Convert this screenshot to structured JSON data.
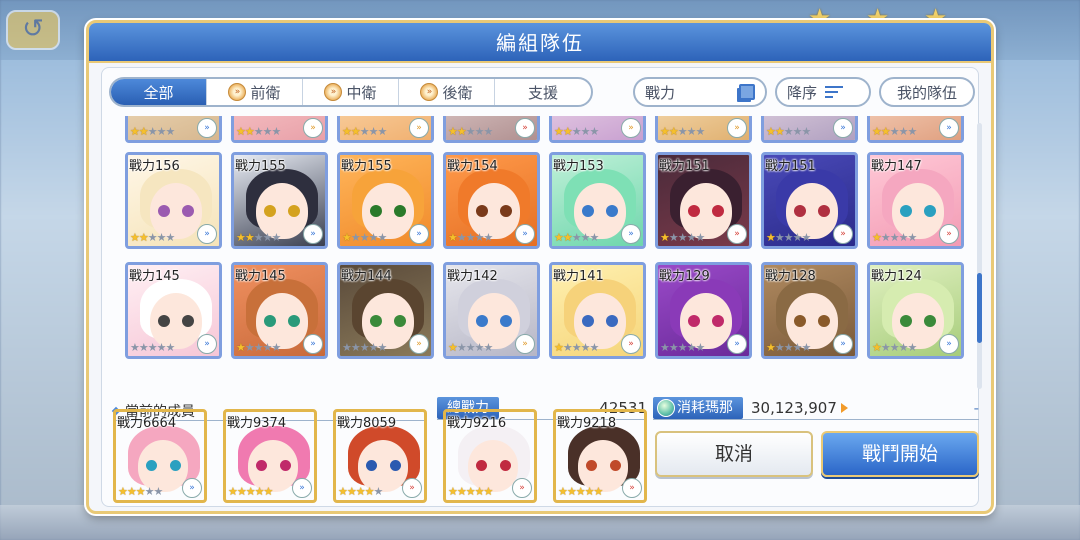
{
  "background": {
    "back_label": "↺"
  },
  "dialog": {
    "title": "編組隊伍"
  },
  "filters": {
    "tabs": [
      {
        "label": "全部",
        "active": true,
        "icon": false
      },
      {
        "label": "前衛",
        "active": false,
        "icon": true
      },
      {
        "label": "中衛",
        "active": false,
        "icon": true
      },
      {
        "label": "後衛",
        "active": false,
        "icon": true
      },
      {
        "label": "支援",
        "active": false,
        "icon": false
      }
    ],
    "sort_key_label": "戰力",
    "sort_order_label": "降序",
    "my_team_label": "我的隊伍"
  },
  "roster_rows": [
    [
      {
        "power": "",
        "stars": 2,
        "arrow": "blue",
        "palette": [
          "#f5e6c8",
          "#d7b78f"
        ]
      },
      {
        "power": "",
        "stars": 2,
        "arrow": "orange",
        "palette": [
          "#ffd6d6",
          "#e8a0a8"
        ]
      },
      {
        "power": "",
        "stars": 2,
        "arrow": "orange",
        "palette": [
          "#ffe5c0",
          "#f0b070"
        ]
      },
      {
        "power": "",
        "stars": 2,
        "arrow": "red",
        "palette": [
          "#f0e0e0",
          "#b09090"
        ]
      },
      {
        "power": "",
        "stars": 2,
        "arrow": "orange",
        "palette": [
          "#f8e7f0",
          "#c8a0d0"
        ]
      },
      {
        "power": "",
        "stars": 2,
        "arrow": "orange",
        "palette": [
          "#fff0d0",
          "#e0b070"
        ]
      },
      {
        "power": "",
        "stars": 2,
        "arrow": "blue",
        "palette": [
          "#f6e6ee",
          "#b0a0c0"
        ]
      },
      {
        "power": "",
        "stars": 2,
        "arrow": "blue",
        "palette": [
          "#ffe8d8",
          "#e0a080"
        ]
      }
    ],
    [
      {
        "power": "戰力156",
        "stars": 2,
        "arrow": "blue",
        "palette": [
          "#fff7e8",
          "#f5e3b8"
        ],
        "hair": "#f6e6c0",
        "eye": "#9b5bb0"
      },
      {
        "power": "戰力155",
        "stars": 2,
        "arrow": "blue",
        "palette": [
          "#e8ecf4",
          "#3a3f50"
        ],
        "hair": "#2e2f3e",
        "eye": "#d4a21f"
      },
      {
        "power": "戰力155",
        "stars": 1,
        "arrow": "blue",
        "palette": [
          "#ffb55a",
          "#f08a2a"
        ],
        "hair": "#f7a33a",
        "eye": "#2a7a2a"
      },
      {
        "power": "戰力154",
        "stars": 1,
        "arrow": "blue",
        "palette": [
          "#ff9a4a",
          "#e56f24"
        ],
        "hair": "#f07a2a",
        "eye": "#7a3a1a"
      },
      {
        "power": "戰力153",
        "stars": 2,
        "arrow": "blue",
        "palette": [
          "#bff0d8",
          "#6ed6ac"
        ],
        "hair": "#7ee0b5",
        "eye": "#3a7acb"
      },
      {
        "power": "戰力151",
        "stars": 1,
        "arrow": "red",
        "palette": [
          "#4a2a3a",
          "#7a3a4a"
        ],
        "hair": "#3a2030",
        "eye": "#c02a40"
      },
      {
        "power": "戰力151",
        "stars": 1,
        "arrow": "red",
        "palette": [
          "#4a4ab8",
          "#2a2a8a"
        ],
        "hair": "#3a3aa8",
        "eye": "#b03040"
      },
      {
        "power": "戰力147",
        "stars": 1,
        "arrow": "red",
        "palette": [
          "#ffc8d6",
          "#f29bb4"
        ],
        "hair": "#f5a7c0",
        "eye": "#2aa0c0"
      }
    ],
    [
      {
        "power": "戰力145",
        "stars": 0,
        "arrow": "blue",
        "palette": [
          "#fff0f4",
          "#f6c6d6"
        ],
        "hair": "#ffffff",
        "eye": "#444444"
      },
      {
        "power": "戰力145",
        "stars": 1,
        "arrow": "blue",
        "palette": [
          "#f09060",
          "#c86a3a"
        ],
        "hair": "#c8703a",
        "eye": "#2a9a7a"
      },
      {
        "power": "戰力144",
        "stars": 0,
        "arrow": "orange",
        "palette": [
          "#5a4a3a",
          "#8a7a5a"
        ],
        "hair": "#5a4530",
        "eye": "#3a8a3a"
      },
      {
        "power": "戰力142",
        "stars": 1,
        "arrow": "orange",
        "palette": [
          "#e6e6ec",
          "#b6b6c6"
        ],
        "hair": "#d0d0dc",
        "eye": "#3a7acb"
      },
      {
        "power": "戰力141",
        "stars": 1,
        "arrow": "red",
        "palette": [
          "#fff0b0",
          "#f5d57a"
        ],
        "hair": "#f6d27a",
        "eye": "#3a6ac0"
      },
      {
        "power": "戰力129",
        "stars": 0,
        "arrow": "blue",
        "palette": [
          "#9a4ac8",
          "#6a2a9a"
        ],
        "hair": "#8a3ab8",
        "eye": "#c02a6a"
      },
      {
        "power": "戰力128",
        "stars": 1,
        "arrow": "blue",
        "palette": [
          "#b08a60",
          "#7a5a3a"
        ],
        "hair": "#8a6a44",
        "eye": "#8a5a2a"
      },
      {
        "power": "戰力124",
        "stars": 1,
        "arrow": "blue",
        "palette": [
          "#e0f0c0",
          "#a6cc7a"
        ],
        "hair": "#d6ecb0",
        "eye": "#3a8a3a"
      }
    ]
  ],
  "current_members": {
    "label": "當前的成員",
    "members": [
      {
        "power": "戰力6664",
        "stars": 3,
        "arrow": "blue",
        "palette": [
          "#ffd6e6",
          "#f29bb4"
        ],
        "hair": "#f5a7c0",
        "eye": "#2aa0c0"
      },
      {
        "power": "戰力9374",
        "stars": 5,
        "arrow": "blue",
        "palette": [
          "#ffb6d6",
          "#e86aa0"
        ],
        "hair": "#f07ab0",
        "eye": "#c02a6a"
      },
      {
        "power": "戰力8059",
        "stars": 4,
        "arrow": "red",
        "palette": [
          "#e86a3a",
          "#a02a1a"
        ],
        "hair": "#d04a2a",
        "eye": "#2a5ab0"
      },
      {
        "power": "戰力9216",
        "stars": 5,
        "arrow": "red",
        "palette": [
          "#fff0f6",
          "#e6c6d6"
        ],
        "hair": "#f4f0f4",
        "eye": "#c02a40"
      },
      {
        "power": "戰力9218",
        "stars": 5,
        "arrow": "red",
        "palette": [
          "#3a2a2a",
          "#6a4a3a"
        ],
        "hair": "#4a3028",
        "eye": "#c04a2a"
      }
    ]
  },
  "stats": {
    "total_power_label": "總戰力",
    "total_power_value": "42531",
    "mana_label": "消耗瑪那",
    "mana_value": "30,123,907",
    "trailing": "-"
  },
  "actions": {
    "cancel_label": "取消",
    "start_label": "戰鬥開始"
  },
  "colors": {
    "accent_blue": "#2d63b9",
    "gold_border": "#e9c976",
    "star_gold": "#f6c02c"
  }
}
